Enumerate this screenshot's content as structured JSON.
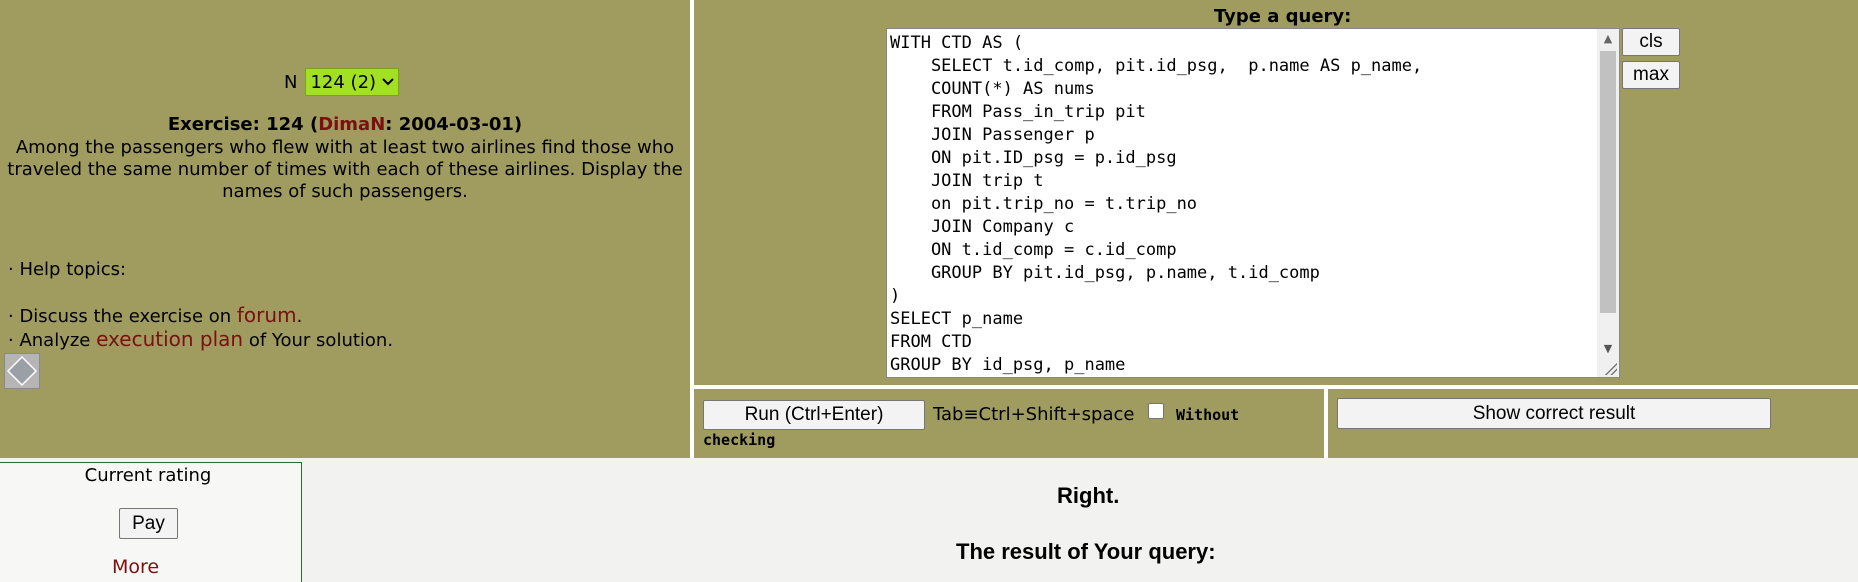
{
  "exercise_selector": {
    "label": "N",
    "selected": "124 (2)"
  },
  "exercise": {
    "prefix": "Exercise: 124 (",
    "author": "DimaN",
    "date": ": 2004-03-01)",
    "text": "Among the passengers who flew with at least two airlines find those who traveled the same number of times with each of these airlines. Display the names of such passengers."
  },
  "help": {
    "topics_label": "· Help topics:",
    "discuss_prefix": "· Discuss the exercise on ",
    "discuss_link": "forum",
    "discuss_suffix": ".",
    "analyze_prefix": "· Analyze ",
    "analyze_link": "execution plan",
    "analyze_suffix": " of Your solution."
  },
  "query": {
    "title": "Type a query:",
    "code": "WITH CTD AS (\n    SELECT t.id_comp, pit.id_psg,  p.name AS p_name,\n    COUNT(*) AS nums\n    FROM Pass_in_trip pit\n    JOIN Passenger p\n    ON pit.ID_psg = p.id_psg\n    JOIN trip t\n    on pit.trip_no = t.trip_no\n    JOIN Company c\n    ON t.id_comp = c.id_comp\n    GROUP BY pit.id_psg, p.name, t.id_comp\n)\nSELECT p_name\nFROM CTD\nGROUP BY id_psg, p_name",
    "cls_label": "cls",
    "max_label": "max"
  },
  "run": {
    "run_label": "Run (Ctrl+Enter)",
    "tab_hint": "Tab≡Ctrl+Shift+space",
    "no_check_1": "Without",
    "no_check_2": "checking"
  },
  "show_result_label": "Show correct result",
  "rating": {
    "title": "Current rating",
    "pay_label": "Pay",
    "more_label": "More"
  },
  "result": {
    "status": "Right.",
    "heading": "The result of Your query:"
  },
  "colors": {
    "panel": "#a09b5f",
    "link": "#7b1010",
    "select_bg": "#a2e022"
  }
}
